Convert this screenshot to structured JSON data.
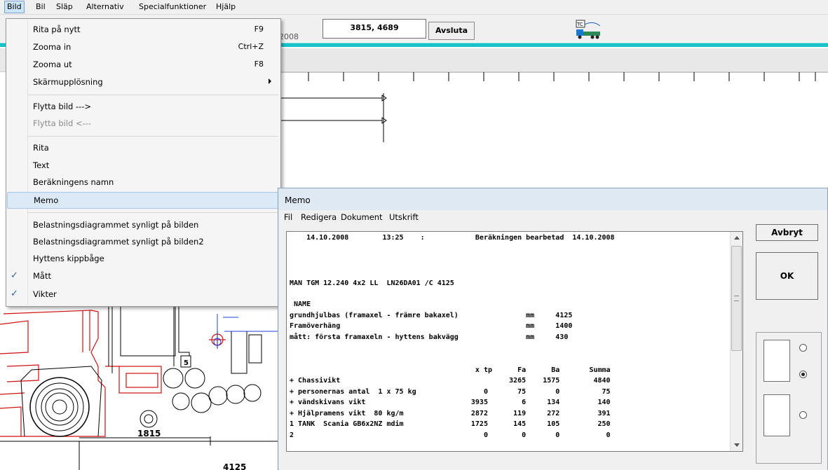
{
  "menubar": {
    "items": [
      "Bild",
      "Bil",
      "Släp",
      "Alternativ",
      "Specialfunktioner",
      "Hjälp"
    ],
    "active": "Bild"
  },
  "toolbar": {
    "year_partial": "2008",
    "coordinates": "3815, 4689",
    "exit_label": "Avsluta"
  },
  "dropdown": {
    "items": [
      {
        "label": "Rita på nytt",
        "shortcut": "F9"
      },
      {
        "label": "Zooma in",
        "shortcut": "Ctrl+Z"
      },
      {
        "label": "Zooma ut",
        "shortcut": "F8"
      },
      {
        "label": "Skärmupplösning",
        "submenu": true
      },
      {
        "label": "Flytta bild --->"
      },
      {
        "label": "Flytta bild <---",
        "disabled": true
      },
      {
        "label": "Rita"
      },
      {
        "label": "Text"
      },
      {
        "label": "Beräkningens namn"
      },
      {
        "label": "Memo",
        "highlighted": true
      },
      {
        "label": "Belastningsdiagrammet synligt på bilden"
      },
      {
        "label": "Belastningsdiagrammet synligt på bilden2"
      },
      {
        "label": "Hyttens kippbåge"
      },
      {
        "label": "Mått",
        "checked": true
      },
      {
        "label": "Vikter",
        "checked": true
      }
    ]
  },
  "drawing": {
    "dim_1815": "1815",
    "dim_4125": "4125",
    "label_5": "5"
  },
  "memo": {
    "title": "Memo",
    "menu": [
      "Fil",
      "Redigera",
      "Dokument",
      "Utskrift"
    ],
    "lines": [
      "    14.10.2008        13:25    :            Beräkningen bearbetad  14.10.2008",
      "",
      "",
      "",
      "MAN TGM 12.240 4x2 LL  LN26DA01 /C 4125",
      "",
      " NAME",
      "grundhjulbas (framaxel - främre bakaxel)                mm     4125",
      "Framöverhäng                                            mm     1400",
      "mått: första framaxeln - hyttens bakvägg                mm     430",
      "",
      "",
      "                                            x tp      Fa      Ba       Summa",
      "+ Chassivikt                                        3265    1575        4840",
      "+ personernas antal  1 x 75 kg                0       75       0          75",
      "+ vändskivans vikt                         3935        6     134         140",
      "+ Hjälpramens vikt  80 kg/m                2872      119     272         391",
      "1 TANK  Scania GB6x2NZ mdim                1725      145     105         250",
      "2                                             0        0       0           0"
    ],
    "cancel_label": "Avbryt",
    "ok_label": "OK",
    "radio_selected": 1
  }
}
